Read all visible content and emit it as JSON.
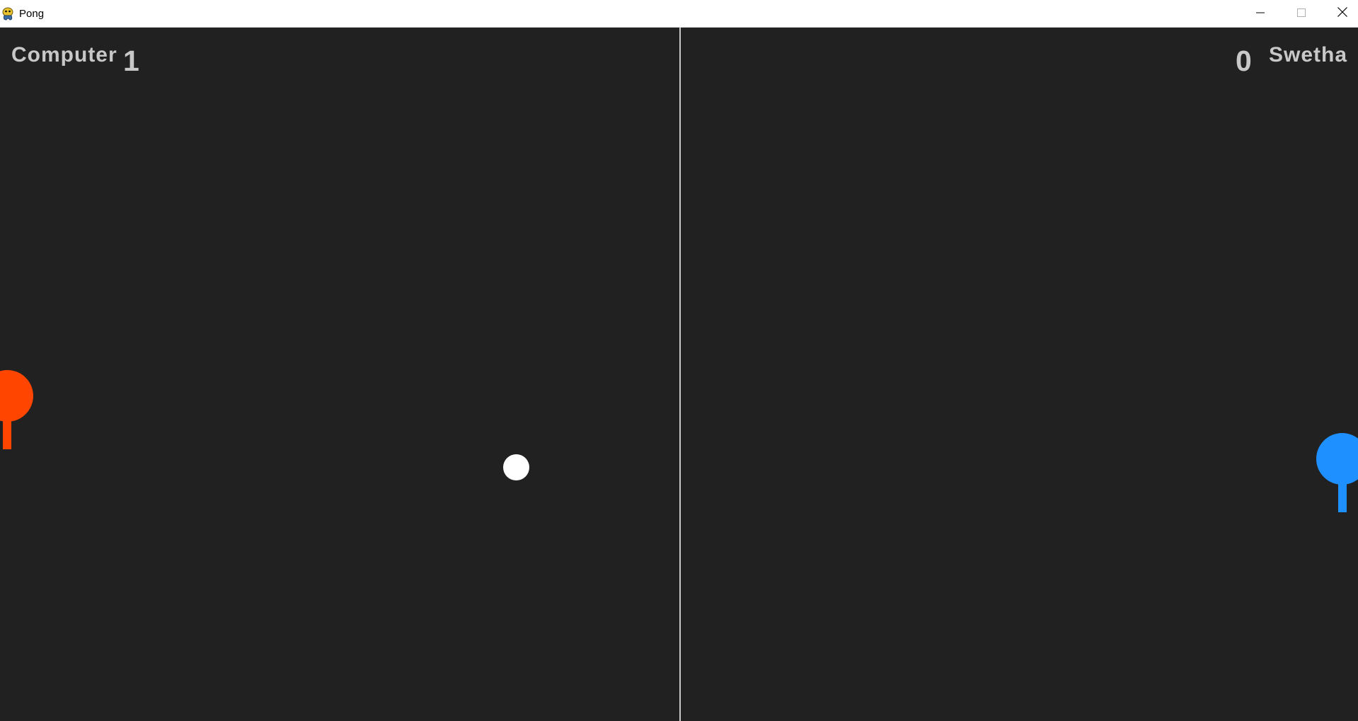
{
  "window": {
    "title": "Pong",
    "icon": "pygame-snake-icon",
    "controls": [
      "minimize-icon",
      "maximize-icon",
      "close-icon"
    ]
  },
  "game": {
    "background_color": "#212121",
    "divider_color": "#c8c8c8",
    "text_color": "#c8c8c8",
    "left_player": {
      "name": "Computer",
      "score": "1",
      "paddle_color": "#ff4500"
    },
    "right_player": {
      "name": "Swetha",
      "score": "0",
      "paddle_color": "#1e90ff"
    },
    "ball_color": "#ffffff"
  }
}
